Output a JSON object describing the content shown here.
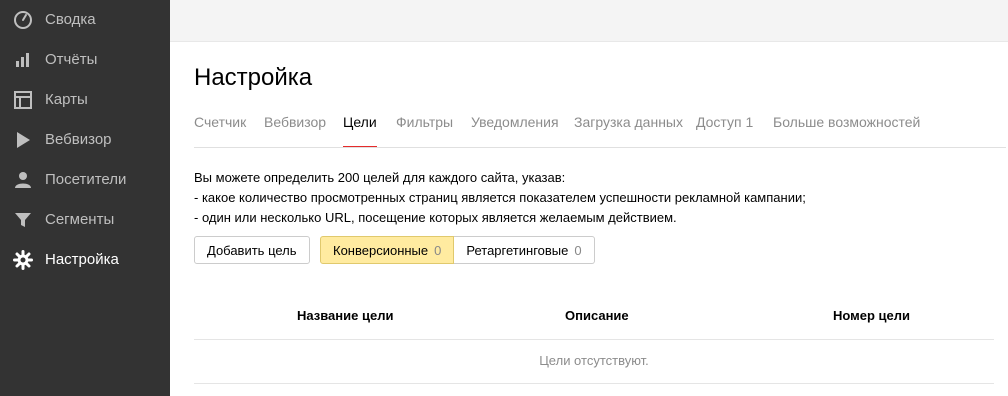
{
  "sidebar": {
    "items": [
      {
        "label": "Сводка",
        "icon": "gauge-icon",
        "active": false
      },
      {
        "label": "Отчёты",
        "icon": "bar-chart-icon",
        "active": false
      },
      {
        "label": "Карты",
        "icon": "map-layout-icon",
        "active": false
      },
      {
        "label": "Вебвизор",
        "icon": "play-icon",
        "active": false
      },
      {
        "label": "Посетители",
        "icon": "user-icon",
        "active": false
      },
      {
        "label": "Сегменты",
        "icon": "filter-funnel-icon",
        "active": false
      },
      {
        "label": "Настройка",
        "icon": "gear-icon",
        "active": true
      }
    ],
    "colors": {
      "background": "#333333",
      "label": "#bfbfbf",
      "active_label": "#ffffff"
    }
  },
  "page": {
    "title": "Настройка"
  },
  "tabs": [
    {
      "label": "Счетчик",
      "active": false
    },
    {
      "label": "Вебвизор",
      "active": false
    },
    {
      "label": "Цели",
      "active": true
    },
    {
      "label": "Фильтры",
      "active": false
    },
    {
      "label": "Уведомления",
      "active": false
    },
    {
      "label": "Загрузка данных",
      "active": false
    },
    {
      "label": "Доступ 1",
      "active": false
    },
    {
      "label": "Больше возможностей",
      "active": false
    }
  ],
  "info": {
    "line1": "Вы можете определить 200 целей для каждого сайта, указав:",
    "line2": "-  какое количество просмотренных страниц является показателем успешности рекламной кампании;",
    "line3": "-  один или несколько URL, посещение которых является желаемым действием."
  },
  "actions": {
    "add_goal": "Добавить цель",
    "segment": [
      {
        "label": "Конверсионные",
        "count": "0",
        "selected": true
      },
      {
        "label": "Ретаргетинговые",
        "count": "0",
        "selected": false
      }
    ]
  },
  "table": {
    "headers": [
      "Название цели",
      "Описание",
      "Номер цели"
    ],
    "empty_text": "Цели отсутствуют."
  },
  "colors": {
    "accent": "#e52b2b",
    "selected_bg": "#ffeba0",
    "topband": "#f4f4f4"
  }
}
